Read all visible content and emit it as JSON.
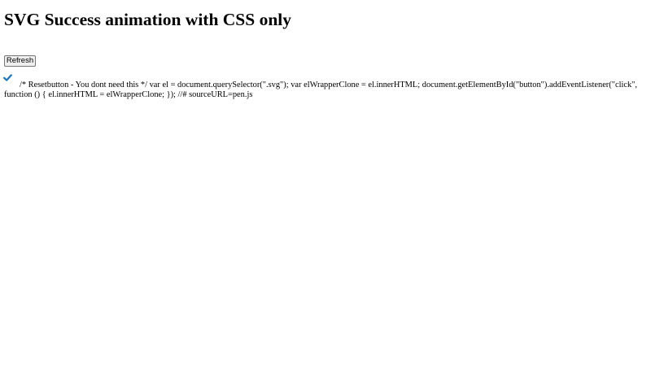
{
  "page": {
    "title": "SVG Success animation with CSS only"
  },
  "controls": {
    "refresh_label": "Refresh"
  },
  "icon": {
    "name": "checkmark-icon",
    "color": "#1d74b8"
  },
  "script_source": {
    "text": "/* Resetbutton - You dont need this */ var el = document.querySelector(\".svg\"); var elWrapperClone = el.innerHTML; document.getElementById(\"button\").addEventListener(\"click\", function () { el.innerHTML = elWrapperClone; }); //# sourceURL=pen.js"
  }
}
